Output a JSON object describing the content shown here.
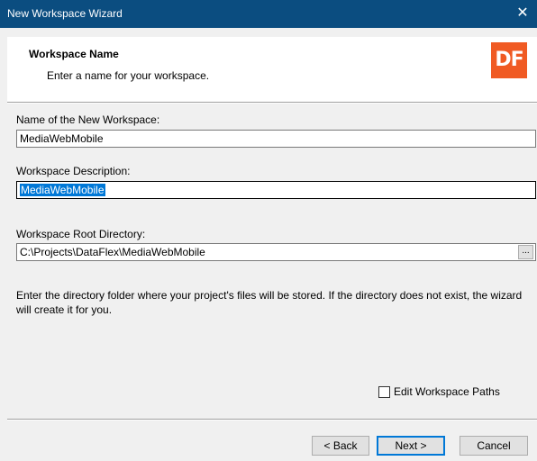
{
  "window": {
    "title": "New Workspace Wizard",
    "close_glyph": "✕"
  },
  "header": {
    "title": "Workspace Name",
    "subtitle": "Enter a name for your workspace.",
    "logo_text": "DF",
    "logo_color": "#f05a23"
  },
  "fields": {
    "name_label": "Name of the New Workspace:",
    "name_value": "MediaWebMobile",
    "description_label": "Workspace Description:",
    "description_value": "MediaWebMobile",
    "root_label": "Workspace Root Directory:",
    "root_value": "C:\\Projects\\DataFlex\\MediaWebMobile",
    "browse_label": "..."
  },
  "help_text": "Enter the directory folder where your project's files will be stored. If the directory does not exist, the wizard will create it for you.",
  "options": {
    "edit_paths_label": "Edit Workspace Paths",
    "edit_paths_checked": false
  },
  "buttons": {
    "back": "< Back",
    "next": "Next >",
    "cancel": "Cancel"
  },
  "colors": {
    "titlebar": "#0b4d80",
    "selection": "#0078d7"
  }
}
